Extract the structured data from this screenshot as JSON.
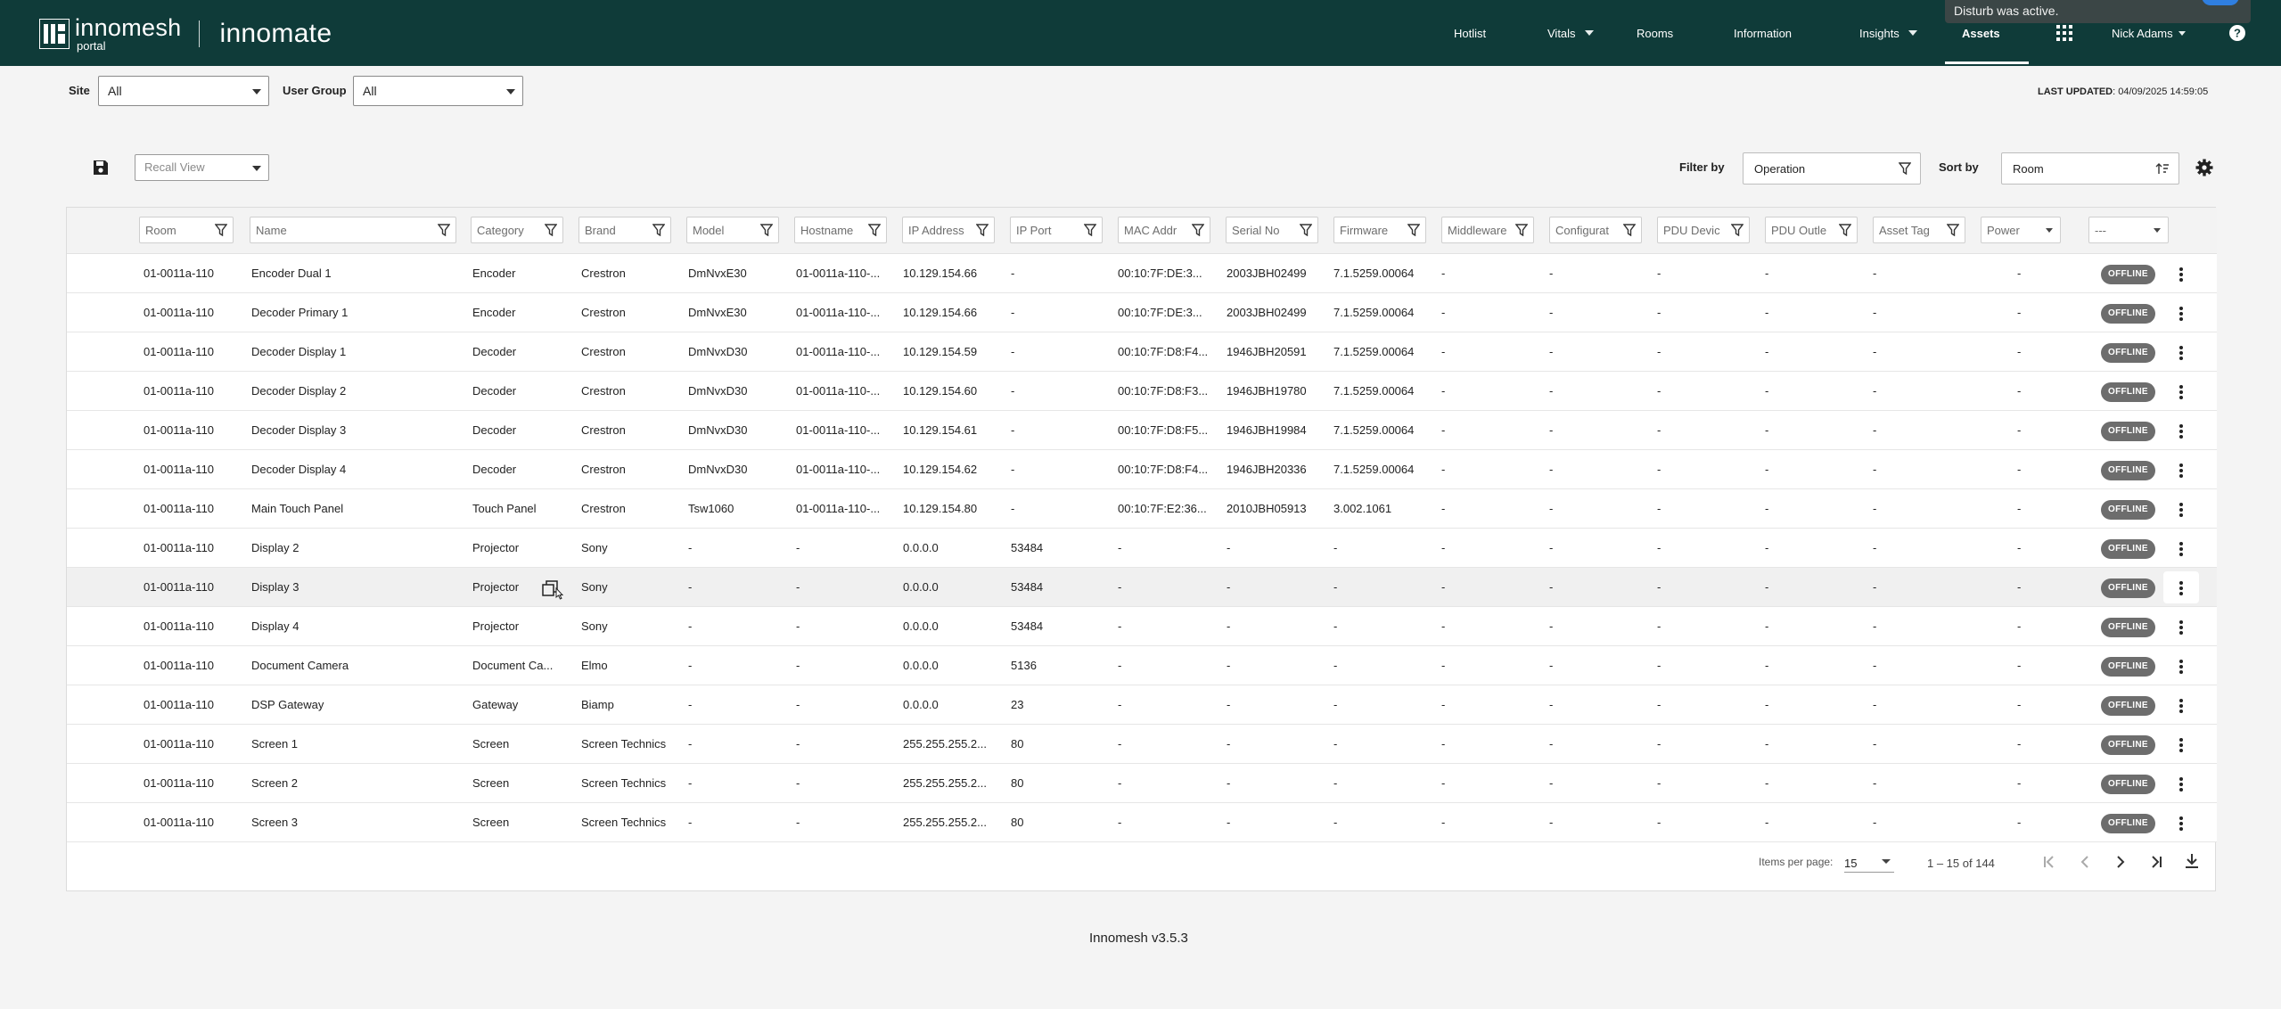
{
  "header": {
    "brand": "innomesh",
    "brand_sub": "portal",
    "app_name": "innomate",
    "nav": [
      {
        "label": "Hotlist"
      },
      {
        "label": "Vitals"
      },
      {
        "label": "Rooms"
      },
      {
        "label": "Information"
      },
      {
        "label": "Insights"
      },
      {
        "label": "Assets"
      }
    ],
    "user": "Nick Adams",
    "toast": "Disturb was active."
  },
  "filters": {
    "site_label": "Site",
    "site_value": "All",
    "group_label": "User Group",
    "group_value": "All",
    "last_updated_label": "LAST UPDATED",
    "last_updated_value": ": 04/09/2025 14:59:05"
  },
  "toolbar": {
    "recall_placeholder": "Recall View",
    "filter_by_label": "Filter by",
    "filter_by_value": "Operation",
    "sort_by_label": "Sort by",
    "sort_by_value": "Room"
  },
  "table": {
    "columns": [
      "Room",
      "Name",
      "Category",
      "Brand",
      "Model",
      "Hostname",
      "IP Address",
      "IP Port",
      "MAC Addr",
      "Serial No",
      "Firmware",
      "Middleware",
      "Configurat",
      "PDU Devic",
      "PDU Outle",
      "Asset Tag",
      "Power",
      "---"
    ],
    "rows": [
      [
        "01-0011a-110",
        "Encoder Dual 1",
        "Encoder",
        "Crestron",
        "DmNvxE30",
        "01-0011a-110-...",
        "10.129.154.66",
        "-",
        "00:10:7F:DE:3...",
        "2003JBH02499",
        "7.1.5259.00064",
        "-",
        "-",
        "-",
        "-",
        "-",
        "-",
        "OFFLINE"
      ],
      [
        "01-0011a-110",
        "Decoder Primary 1",
        "Encoder",
        "Crestron",
        "DmNvxE30",
        "01-0011a-110-...",
        "10.129.154.66",
        "-",
        "00:10:7F:DE:3...",
        "2003JBH02499",
        "7.1.5259.00064",
        "-",
        "-",
        "-",
        "-",
        "-",
        "-",
        "OFFLINE"
      ],
      [
        "01-0011a-110",
        "Decoder Display 1",
        "Decoder",
        "Crestron",
        "DmNvxD30",
        "01-0011a-110-...",
        "10.129.154.59",
        "-",
        "00:10:7F:D8:F4...",
        "1946JBH20591",
        "7.1.5259.00064",
        "-",
        "-",
        "-",
        "-",
        "-",
        "-",
        "OFFLINE"
      ],
      [
        "01-0011a-110",
        "Decoder Display 2",
        "Decoder",
        "Crestron",
        "DmNvxD30",
        "01-0011a-110-...",
        "10.129.154.60",
        "-",
        "00:10:7F:D8:F3...",
        "1946JBH19780",
        "7.1.5259.00064",
        "-",
        "-",
        "-",
        "-",
        "-",
        "-",
        "OFFLINE"
      ],
      [
        "01-0011a-110",
        "Decoder Display 3",
        "Decoder",
        "Crestron",
        "DmNvxD30",
        "01-0011a-110-...",
        "10.129.154.61",
        "-",
        "00:10:7F:D8:F5...",
        "1946JBH19984",
        "7.1.5259.00064",
        "-",
        "-",
        "-",
        "-",
        "-",
        "-",
        "OFFLINE"
      ],
      [
        "01-0011a-110",
        "Decoder Display 4",
        "Decoder",
        "Crestron",
        "DmNvxD30",
        "01-0011a-110-...",
        "10.129.154.62",
        "-",
        "00:10:7F:D8:F4...",
        "1946JBH20336",
        "7.1.5259.00064",
        "-",
        "-",
        "-",
        "-",
        "-",
        "-",
        "OFFLINE"
      ],
      [
        "01-0011a-110",
        "Main Touch Panel",
        "Touch Panel",
        "Crestron",
        "Tsw1060",
        "01-0011a-110-...",
        "10.129.154.80",
        "-",
        "00:10:7F:E2:36...",
        "2010JBH05913",
        "3.002.1061",
        "-",
        "-",
        "-",
        "-",
        "-",
        "-",
        "OFFLINE"
      ],
      [
        "01-0011a-110",
        "Display 2",
        "Projector",
        "Sony",
        "-",
        "-",
        "0.0.0.0",
        "53484",
        "-",
        "-",
        "-",
        "-",
        "-",
        "-",
        "-",
        "-",
        "-",
        "OFFLINE"
      ],
      [
        "01-0011a-110",
        "Display 3",
        "Projector",
        "Sony",
        "-",
        "-",
        "0.0.0.0",
        "53484",
        "-",
        "-",
        "-",
        "-",
        "-",
        "-",
        "-",
        "-",
        "-",
        "OFFLINE"
      ],
      [
        "01-0011a-110",
        "Display 4",
        "Projector",
        "Sony",
        "-",
        "-",
        "0.0.0.0",
        "53484",
        "-",
        "-",
        "-",
        "-",
        "-",
        "-",
        "-",
        "-",
        "-",
        "OFFLINE"
      ],
      [
        "01-0011a-110",
        "Document Camera",
        "Document Ca...",
        "Elmo",
        "-",
        "-",
        "0.0.0.0",
        "5136",
        "-",
        "-",
        "-",
        "-",
        "-",
        "-",
        "-",
        "-",
        "-",
        "OFFLINE"
      ],
      [
        "01-0011a-110",
        "DSP Gateway",
        "Gateway",
        "Biamp",
        "-",
        "-",
        "0.0.0.0",
        "23",
        "-",
        "-",
        "-",
        "-",
        "-",
        "-",
        "-",
        "-",
        "-",
        "OFFLINE"
      ],
      [
        "01-0011a-110",
        "Screen 1",
        "Screen",
        "Screen Technics",
        "-",
        "-",
        "255.255.255.2...",
        "80",
        "-",
        "-",
        "-",
        "-",
        "-",
        "-",
        "-",
        "-",
        "-",
        "OFFLINE"
      ],
      [
        "01-0011a-110",
        "Screen 2",
        "Screen",
        "Screen Technics",
        "-",
        "-",
        "255.255.255.2...",
        "80",
        "-",
        "-",
        "-",
        "-",
        "-",
        "-",
        "-",
        "-",
        "-",
        "OFFLINE"
      ],
      [
        "01-0011a-110",
        "Screen 3",
        "Screen",
        "Screen Technics",
        "-",
        "-",
        "255.255.255.2...",
        "80",
        "-",
        "-",
        "-",
        "-",
        "-",
        "-",
        "-",
        "-",
        "-",
        "OFFLINE"
      ]
    ]
  },
  "pagination": {
    "items_per_page_label": "Items per page:",
    "items_per_page_value": "15",
    "range": "1 – 15 of 144"
  },
  "footer": {
    "version": "Innomesh v3.5.3"
  },
  "colors": {
    "nav_bg": "#0f3b39",
    "badge_offline": "#6d6d6d"
  }
}
